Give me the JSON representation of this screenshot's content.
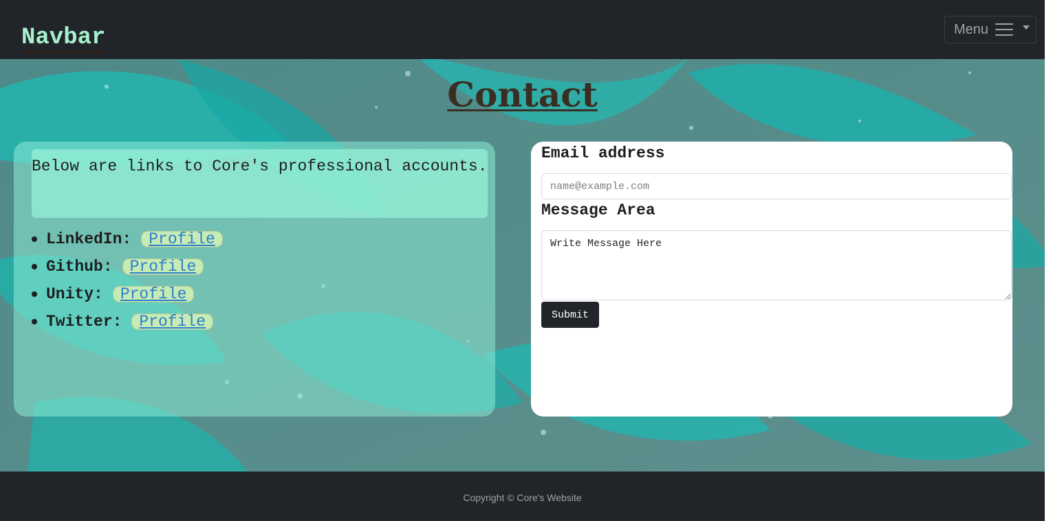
{
  "navbar": {
    "brand": "Navbar",
    "menu_label": "Menu",
    "menu_icon": "hamburger-icon",
    "caret_icon": "caret-down-icon"
  },
  "contact": {
    "title": "Contact",
    "intro": "Below are links to Core's professional accounts.",
    "links": [
      {
        "label": "LinkedIn:",
        "link_text": "Profile"
      },
      {
        "label": "Github:",
        "link_text": "Profile"
      },
      {
        "label": "Unity:",
        "link_text": "Profile"
      },
      {
        "label": "Twitter:",
        "link_text": "Profile"
      }
    ]
  },
  "form": {
    "email_label": "Email address",
    "email_placeholder": "name@example.com",
    "email_value": "",
    "message_label": "Message Area",
    "message_value": "Write Message Here",
    "submit_label": "Submit"
  },
  "footer": {
    "copyright": "Copyright © Core's Website"
  },
  "colors": {
    "dark": "#212529",
    "brand_text": "#a6f0cd",
    "teal_background": "#1fb6b0",
    "link": "#2d7fcf"
  }
}
